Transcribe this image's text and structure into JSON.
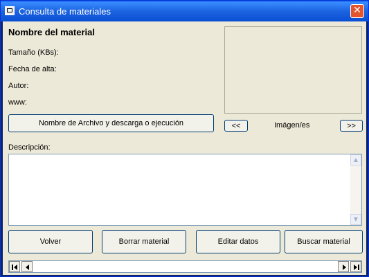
{
  "window": {
    "title": "Consulta de materiales",
    "close_symbol": "✕"
  },
  "details": {
    "heading": "Nombre del material",
    "size_label": "Tamaño (KBs):",
    "date_label": "Fecha de alta:",
    "author_label": "Autor:",
    "www_label": "www:"
  },
  "file_button": "Nombre de Archivo y descarga o ejecución",
  "images": {
    "prev_label": "<<",
    "caption": "Imágen/es",
    "next_label": ">>"
  },
  "description": {
    "label": "Descripción:",
    "value": ""
  },
  "actions": {
    "back": "Volver",
    "delete": "Borrar material",
    "edit": "Editar datos",
    "search": "Buscar material"
  },
  "colors": {
    "titlebar": "#1c64e0",
    "client": "#ece9d8",
    "close": "#e4552d"
  }
}
